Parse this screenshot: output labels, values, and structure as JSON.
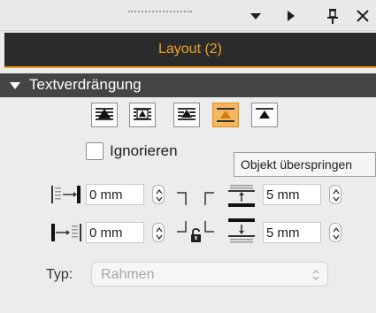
{
  "panel": {
    "title": "Layout (2)"
  },
  "window_icons": [
    "menu-triangle-icon",
    "play-icon",
    "pin-icon",
    "close-icon"
  ],
  "section": {
    "title": "Textverdrängung",
    "expanded": true
  },
  "wrap_modes": [
    {
      "icon": "wrap-none-icon",
      "active": false
    },
    {
      "icon": "wrap-bounding-box-icon",
      "active": false
    },
    {
      "icon": "wrap-object-shape-icon",
      "active": false
    },
    {
      "icon": "wrap-jump-object-icon",
      "active": true
    },
    {
      "icon": "wrap-jump-to-next-column-icon",
      "active": false
    }
  ],
  "ignore_checkbox": {
    "label": "Ignorieren",
    "checked": false
  },
  "tooltip": "Objekt überspringen",
  "offsets": {
    "left": "0 mm",
    "right": "0 mm",
    "top": "5 mm",
    "bottom": "5 mm",
    "linked": true
  },
  "type": {
    "label": "Typ:",
    "value": "Rahmen",
    "enabled": false
  },
  "colors": {
    "accent": "#f29a1a",
    "header_bg": "#2b2b2b",
    "section_bg": "#454545",
    "active_button": "#f5b760"
  }
}
